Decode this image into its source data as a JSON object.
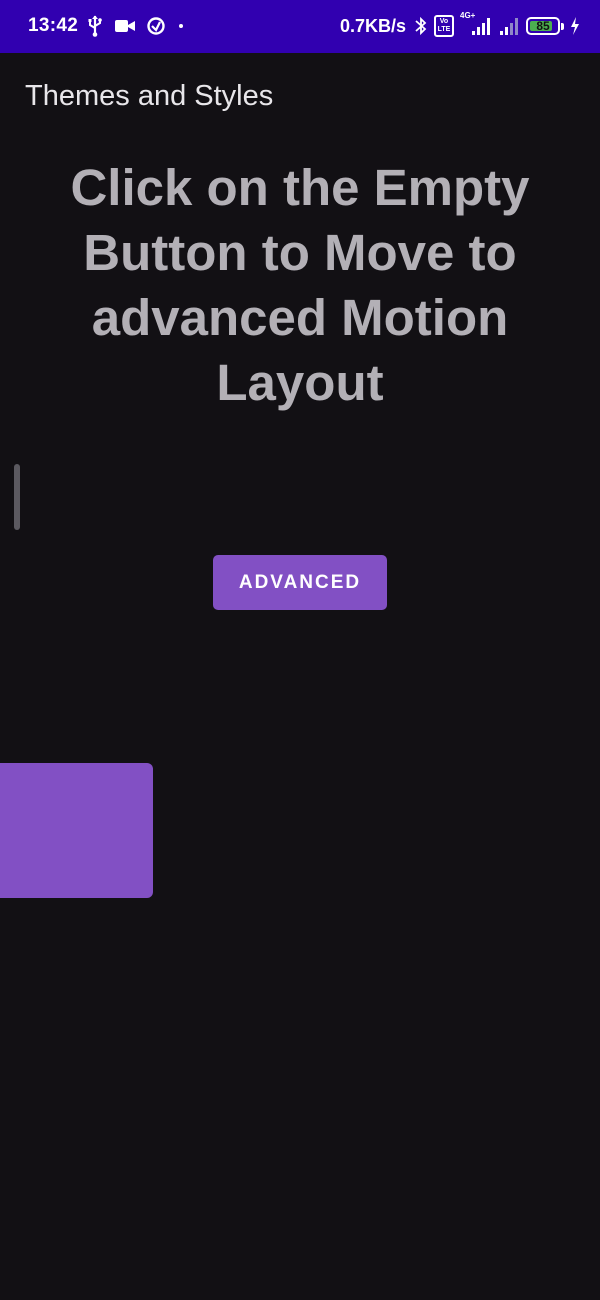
{
  "status_bar": {
    "time": "13:42",
    "net_speed": "0.7KB/s",
    "battery_level": "85",
    "battery_fraction": 0.85,
    "volte_label": "Vo LTE",
    "network_label": "4G+",
    "left_icons": [
      "usb-icon",
      "video-camera-icon",
      "data-saver-icon",
      "dot-icon"
    ],
    "right_icons": [
      "bluetooth-icon",
      "volte-icon",
      "signal-4g-icon",
      "signal-icon",
      "battery-icon",
      "charging-bolt-icon"
    ],
    "background": "#3100b0"
  },
  "app_bar": {
    "title": "Themes and Styles"
  },
  "main": {
    "headline": "Click on the Empty Button to Move to advanced Motion Layout",
    "advanced_button_label": "ADVANCED",
    "accent_color": "#8250c4",
    "background": "#121014"
  }
}
